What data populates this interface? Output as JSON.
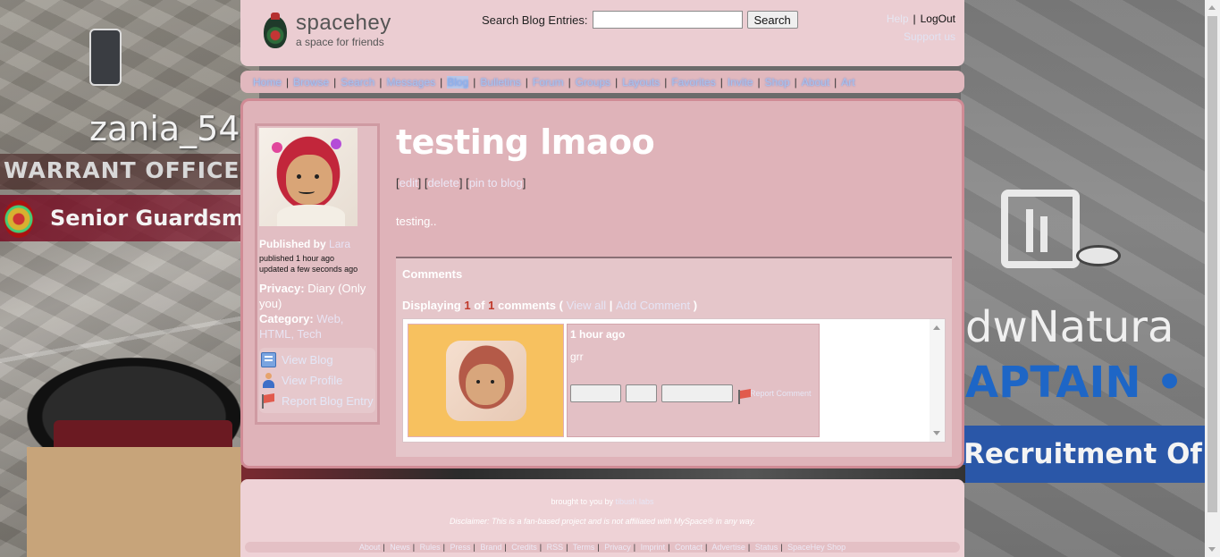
{
  "background": {
    "overlay_name": "zania_54",
    "rank_text": "WARRANT OFFICE",
    "role_text": "Senior Guardsma",
    "right_text_1": "dwNatura",
    "right_text_2": "APTAIN •",
    "right_text_3": "Recruitment Of"
  },
  "header": {
    "logo_name": "spacehey",
    "logo_tagline": "a space for friends",
    "search_label": "Search Blog Entries:",
    "search_value": "",
    "search_button": "Search",
    "help_link": "Help",
    "logout_link": "LogOut",
    "support_link": "Support us"
  },
  "nav": {
    "items": [
      "Home",
      "Browse",
      "Search",
      "Messages",
      "Blog",
      "Bulletins",
      "Forum",
      "Groups",
      "Layouts",
      "Favorites",
      "Invite",
      "Shop",
      "About",
      "Art"
    ],
    "active": "Blog"
  },
  "sidebar": {
    "published_label": "Published by",
    "author": "Lara",
    "published_time": "published 1 hour ago",
    "updated_time": "updated a few seconds ago",
    "privacy_label": "Privacy:",
    "privacy_value": "Diary (Only you)",
    "category_label": "Category:",
    "categories": "Web, HTML, Tech",
    "actions": [
      "View Blog",
      "View Profile",
      "Report Blog Entry"
    ]
  },
  "post": {
    "title": "testing lmaoo",
    "edit_links": [
      "edit",
      "delete",
      "pin to blog"
    ],
    "body": "testing.."
  },
  "comments": {
    "heading": "Comments",
    "displaying_label": "Displaying",
    "shown": "1",
    "of_label": "of",
    "total": "1",
    "comments_label": "comments (",
    "view_all": "View all",
    "add_comment": "Add Comment",
    "close_paren": ")",
    "items": [
      {
        "time": "1 hour ago",
        "text": "grr",
        "report_label": "Report Comment"
      }
    ]
  },
  "footer": {
    "brought_prefix": "brought to you by",
    "brought_link": "tibush labs",
    "disclaimer": "Disclaimer: This is a fan-based project and is not affiliated with MySpace® in any way.",
    "links": [
      "About",
      "News",
      "Rules",
      "Press",
      "Brand",
      "Credits",
      "RSS",
      "Terms",
      "Privacy",
      "Imprint",
      "Contact",
      "Advertise",
      "Status",
      "SpaceHey Shop"
    ]
  },
  "colors": {
    "panel_pink": "#ebcdd2",
    "main_pink": "#dfb3b9",
    "border_pink": "#d08b95",
    "count_red": "#c0392b",
    "link_faint_blue": "#e6e4f5"
  }
}
